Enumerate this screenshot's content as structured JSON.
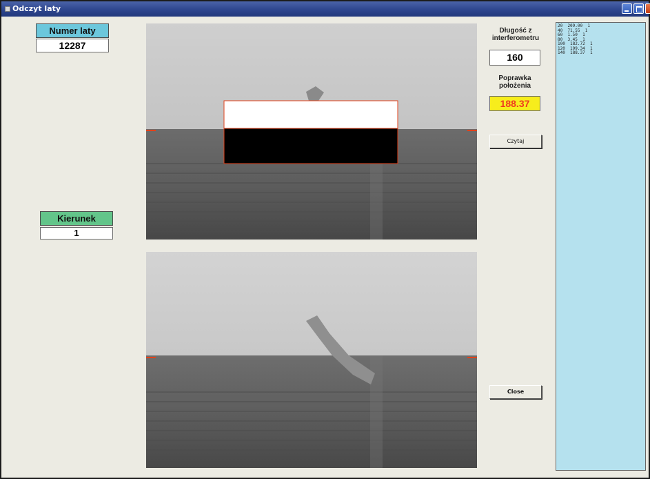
{
  "window": {
    "title": "Odczyt laty"
  },
  "numer_laty": {
    "label": "Numer laty",
    "value": "12287"
  },
  "kierunek": {
    "label": "Kierunek",
    "value": "1"
  },
  "dlugosc": {
    "label_line1": "Długość z",
    "label_line2": "interferometru",
    "value": "160"
  },
  "poprawka": {
    "label_line1": "Poprawka",
    "label_line2": "położenia",
    "value": "188.37"
  },
  "buttons": {
    "czytaj": "Czytaj",
    "close": "Close"
  },
  "results_list": [
    "20  209.00  1",
    "40  71.55  1",
    "60  1.50  1",
    "80  3.45  1",
    "100  182.72  1",
    "120  199.34  1",
    "140  188.37  1"
  ],
  "colors": {
    "title_bar": "#2e468f",
    "numer_label_bg": "#6cc7dc",
    "kierunek_label_bg": "#63c58a",
    "correction_bg": "#f7ed1c",
    "correction_text": "#ef3a20",
    "listbox_bg": "#b5e1ee",
    "marker": "#e2421b"
  },
  "icons": [
    "app-icon",
    "minimize-icon",
    "maximize-icon",
    "close-icon"
  ]
}
